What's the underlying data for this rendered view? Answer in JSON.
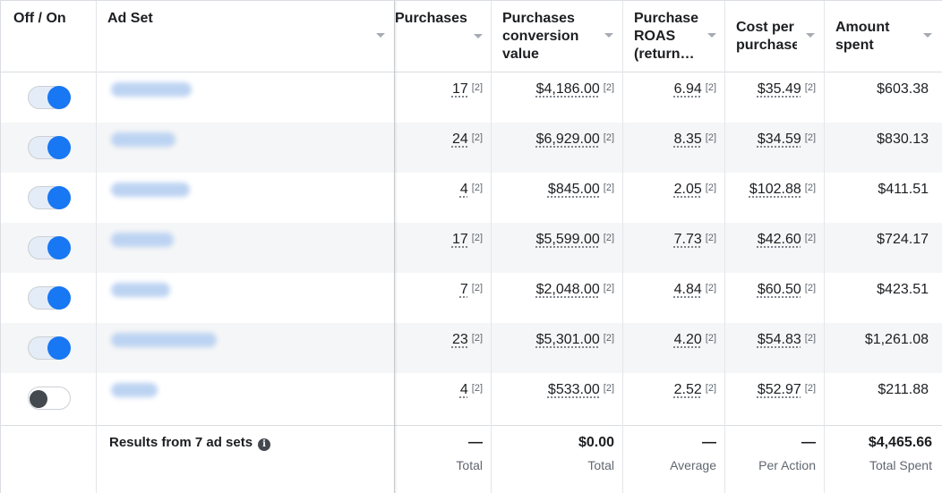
{
  "headers": {
    "toggle": "Off / On",
    "adset": "Ad Set",
    "purchases": "Purchases",
    "pcv": [
      "Purchases",
      "conversion",
      "value"
    ],
    "roas": [
      "Purchase",
      "ROAS",
      "(return…"
    ],
    "cpp": [
      "Cost per",
      "purchase"
    ],
    "spent": [
      "Amount",
      "spent"
    ]
  },
  "ref_marker": "[2]",
  "rows": [
    {
      "on": true,
      "purchases": "17",
      "pcv": "$4,186.00",
      "roas": "6.94",
      "cpp": "$35.49",
      "spent": "$603.38"
    },
    {
      "on": true,
      "purchases": "24",
      "pcv": "$6,929.00",
      "roas": "8.35",
      "cpp": "$34.59",
      "spent": "$830.13"
    },
    {
      "on": true,
      "purchases": "4",
      "pcv": "$845.00",
      "roas": "2.05",
      "cpp": "$102.88",
      "spent": "$411.51"
    },
    {
      "on": true,
      "purchases": "17",
      "pcv": "$5,599.00",
      "roas": "7.73",
      "cpp": "$42.60",
      "spent": "$724.17"
    },
    {
      "on": true,
      "purchases": "7",
      "pcv": "$2,048.00",
      "roas": "4.84",
      "cpp": "$60.50",
      "spent": "$423.51"
    },
    {
      "on": true,
      "purchases": "23",
      "pcv": "$5,301.00",
      "roas": "4.20",
      "cpp": "$54.83",
      "spent": "$1,261.08"
    },
    {
      "on": false,
      "purchases": "4",
      "pcv": "$533.00",
      "roas": "2.52",
      "cpp": "$52.97",
      "spent": "$211.88"
    }
  ],
  "footer": {
    "results": "Results from 7 ad sets",
    "info_icon": "i",
    "purchases": {
      "value": "—",
      "label": "Total"
    },
    "pcv": {
      "value": "$0.00",
      "label": "Total"
    },
    "roas": {
      "value": "—",
      "label": "Average"
    },
    "cpp": {
      "value": "—",
      "label": "Per Action"
    },
    "spent": {
      "value": "$4,465.66",
      "label": "Total Spent"
    }
  },
  "colors": {
    "accent": "#1877f2",
    "row_alt": "#f5f6f7",
    "border": "#dadde1"
  }
}
